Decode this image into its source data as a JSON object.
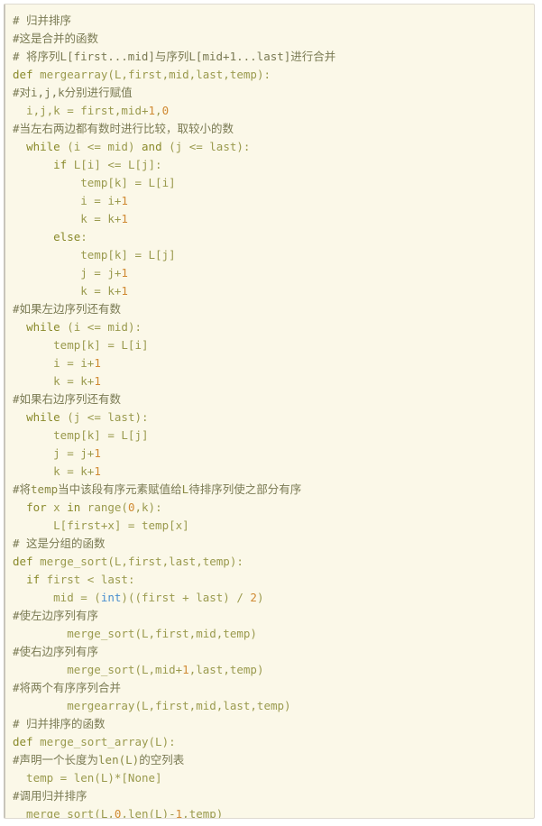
{
  "code_block": {
    "language": "python",
    "background_color": "#fbf8e8",
    "border_color": "#dedad0",
    "accent_border_color": "#c9c5bb",
    "token_colors": {
      "comment": "#7a7a53",
      "keyword": "#8a8a2b",
      "identifier": "#9a9a4e",
      "number": "#d08a33",
      "builtin": "#4a8fcf"
    },
    "lines": [
      [
        {
          "t": "# 归并排序",
          "c": "tok-comment"
        }
      ],
      [
        {
          "t": "#这是合并的函数",
          "c": "tok-comment"
        }
      ],
      [
        {
          "t": "# 将序列L[first...mid]与序列L[mid+1...last]进行合并",
          "c": "tok-comment"
        }
      ],
      [
        {
          "t": "def ",
          "c": "tok-def"
        },
        {
          "t": "mergearray",
          "c": "tok-fn"
        },
        {
          "t": "(L,first,mid,last,temp):",
          "c": "tok-punct"
        }
      ],
      [
        {
          "t": "#对i,j,k分别进行赋值",
          "c": "tok-comment"
        }
      ],
      [
        {
          "t": "  i,j,k = first,mid+",
          "c": "tok-id"
        },
        {
          "t": "1",
          "c": "tok-num"
        },
        {
          "t": ",",
          "c": "tok-punct"
        },
        {
          "t": "0",
          "c": "tok-num"
        }
      ],
      [
        {
          "t": "#当左右两边都有数时进行比较，取较小的数",
          "c": "tok-comment"
        }
      ],
      [
        {
          "t": "  ",
          "c": "tok-id"
        },
        {
          "t": "while",
          "c": "tok-kw"
        },
        {
          "t": " (i <= mid) ",
          "c": "tok-id"
        },
        {
          "t": "and",
          "c": "tok-kw"
        },
        {
          "t": " (j <= last):",
          "c": "tok-id"
        }
      ],
      [
        {
          "t": "      ",
          "c": "tok-id"
        },
        {
          "t": "if",
          "c": "tok-kw"
        },
        {
          "t": " L[i] <= L[j]:",
          "c": "tok-id"
        }
      ],
      [
        {
          "t": "          temp[k] = L[i]",
          "c": "tok-id"
        }
      ],
      [
        {
          "t": "          i = i+",
          "c": "tok-id"
        },
        {
          "t": "1",
          "c": "tok-num"
        }
      ],
      [
        {
          "t": "          k = k+",
          "c": "tok-id"
        },
        {
          "t": "1",
          "c": "tok-num"
        }
      ],
      [
        {
          "t": "      ",
          "c": "tok-id"
        },
        {
          "t": "else",
          "c": "tok-kw"
        },
        {
          "t": ":",
          "c": "tok-id"
        }
      ],
      [
        {
          "t": "          temp[k] = L[j]",
          "c": "tok-id"
        }
      ],
      [
        {
          "t": "          j = j+",
          "c": "tok-id"
        },
        {
          "t": "1",
          "c": "tok-num"
        }
      ],
      [
        {
          "t": "          k = k+",
          "c": "tok-id"
        },
        {
          "t": "1",
          "c": "tok-num"
        }
      ],
      [
        {
          "t": "#如果左边序列还有数",
          "c": "tok-comment"
        }
      ],
      [
        {
          "t": "  ",
          "c": "tok-id"
        },
        {
          "t": "while",
          "c": "tok-kw"
        },
        {
          "t": " (i <= mid):",
          "c": "tok-id"
        }
      ],
      [
        {
          "t": "      temp[k] = L[i]",
          "c": "tok-id"
        }
      ],
      [
        {
          "t": "      i = i+",
          "c": "tok-id"
        },
        {
          "t": "1",
          "c": "tok-num"
        }
      ],
      [
        {
          "t": "      k = k+",
          "c": "tok-id"
        },
        {
          "t": "1",
          "c": "tok-num"
        }
      ],
      [
        {
          "t": "#如果右边序列还有数",
          "c": "tok-comment"
        }
      ],
      [
        {
          "t": "  ",
          "c": "tok-id"
        },
        {
          "t": "while",
          "c": "tok-kw"
        },
        {
          "t": " (j <= last):",
          "c": "tok-id"
        }
      ],
      [
        {
          "t": "      temp[k] = L[j]",
          "c": "tok-id"
        }
      ],
      [
        {
          "t": "      j = j+",
          "c": "tok-id"
        },
        {
          "t": "1",
          "c": "tok-num"
        }
      ],
      [
        {
          "t": "      k = k+",
          "c": "tok-id"
        },
        {
          "t": "1",
          "c": "tok-num"
        }
      ],
      [
        {
          "t": "#将",
          "c": "tok-comment"
        },
        {
          "t": "temp",
          "c": "tok-comment-code"
        },
        {
          "t": "当中该段有序元素赋值给",
          "c": "tok-comment"
        },
        {
          "t": "L",
          "c": "tok-comment-code"
        },
        {
          "t": "待排序列使之部分有序",
          "c": "tok-comment"
        }
      ],
      [
        {
          "t": "  ",
          "c": "tok-id"
        },
        {
          "t": "for",
          "c": "tok-kw"
        },
        {
          "t": " x ",
          "c": "tok-id"
        },
        {
          "t": "in",
          "c": "tok-kw"
        },
        {
          "t": " range(",
          "c": "tok-id"
        },
        {
          "t": "0",
          "c": "tok-num"
        },
        {
          "t": ",k):",
          "c": "tok-id"
        }
      ],
      [
        {
          "t": "      L[first+x] = temp[x]",
          "c": "tok-id"
        }
      ],
      [
        {
          "t": "# 这是分组的函数",
          "c": "tok-comment"
        }
      ],
      [
        {
          "t": "def ",
          "c": "tok-def"
        },
        {
          "t": "merge_sort",
          "c": "tok-fn"
        },
        {
          "t": "(L,first,last,temp):",
          "c": "tok-punct"
        }
      ],
      [
        {
          "t": "  ",
          "c": "tok-id"
        },
        {
          "t": "if",
          "c": "tok-kw"
        },
        {
          "t": " first < last:",
          "c": "tok-id"
        }
      ],
      [
        {
          "t": "      mid = (",
          "c": "tok-id"
        },
        {
          "t": "int",
          "c": "tok-builtin"
        },
        {
          "t": ")((first + last) / ",
          "c": "tok-id"
        },
        {
          "t": "2",
          "c": "tok-num"
        },
        {
          "t": ")",
          "c": "tok-id"
        }
      ],
      [
        {
          "t": "#使左边序列有序",
          "c": "tok-comment"
        }
      ],
      [
        {
          "t": "        merge_sort(L,first,mid,temp)",
          "c": "tok-id"
        }
      ],
      [
        {
          "t": "#使右边序列有序",
          "c": "tok-comment"
        }
      ],
      [
        {
          "t": "        merge_sort(L,mid+",
          "c": "tok-id"
        },
        {
          "t": "1",
          "c": "tok-num"
        },
        {
          "t": ",last,temp)",
          "c": "tok-id"
        }
      ],
      [
        {
          "t": "#将两个有序序列合并",
          "c": "tok-comment"
        }
      ],
      [
        {
          "t": "        mergearray(L,first,mid,last,temp)",
          "c": "tok-id"
        }
      ],
      [
        {
          "t": "# 归并排序的函数",
          "c": "tok-comment"
        }
      ],
      [
        {
          "t": "def ",
          "c": "tok-def"
        },
        {
          "t": "merge_sort_array",
          "c": "tok-fn"
        },
        {
          "t": "(L):",
          "c": "tok-punct"
        }
      ],
      [
        {
          "t": "#声明一个长度为",
          "c": "tok-comment"
        },
        {
          "t": "len(L)",
          "c": "tok-comment-code"
        },
        {
          "t": "的空列表",
          "c": "tok-comment"
        }
      ],
      [
        {
          "t": "  temp = len(L)*[None]",
          "c": "tok-id"
        }
      ],
      [
        {
          "t": "#调用归并排序",
          "c": "tok-comment"
        }
      ],
      [
        {
          "t": "  merge_sort(L,",
          "c": "tok-id"
        },
        {
          "t": "0",
          "c": "tok-num"
        },
        {
          "t": ",len(L)-",
          "c": "tok-id"
        },
        {
          "t": "1",
          "c": "tok-num"
        },
        {
          "t": ",temp)",
          "c": "tok-id"
        }
      ]
    ]
  }
}
